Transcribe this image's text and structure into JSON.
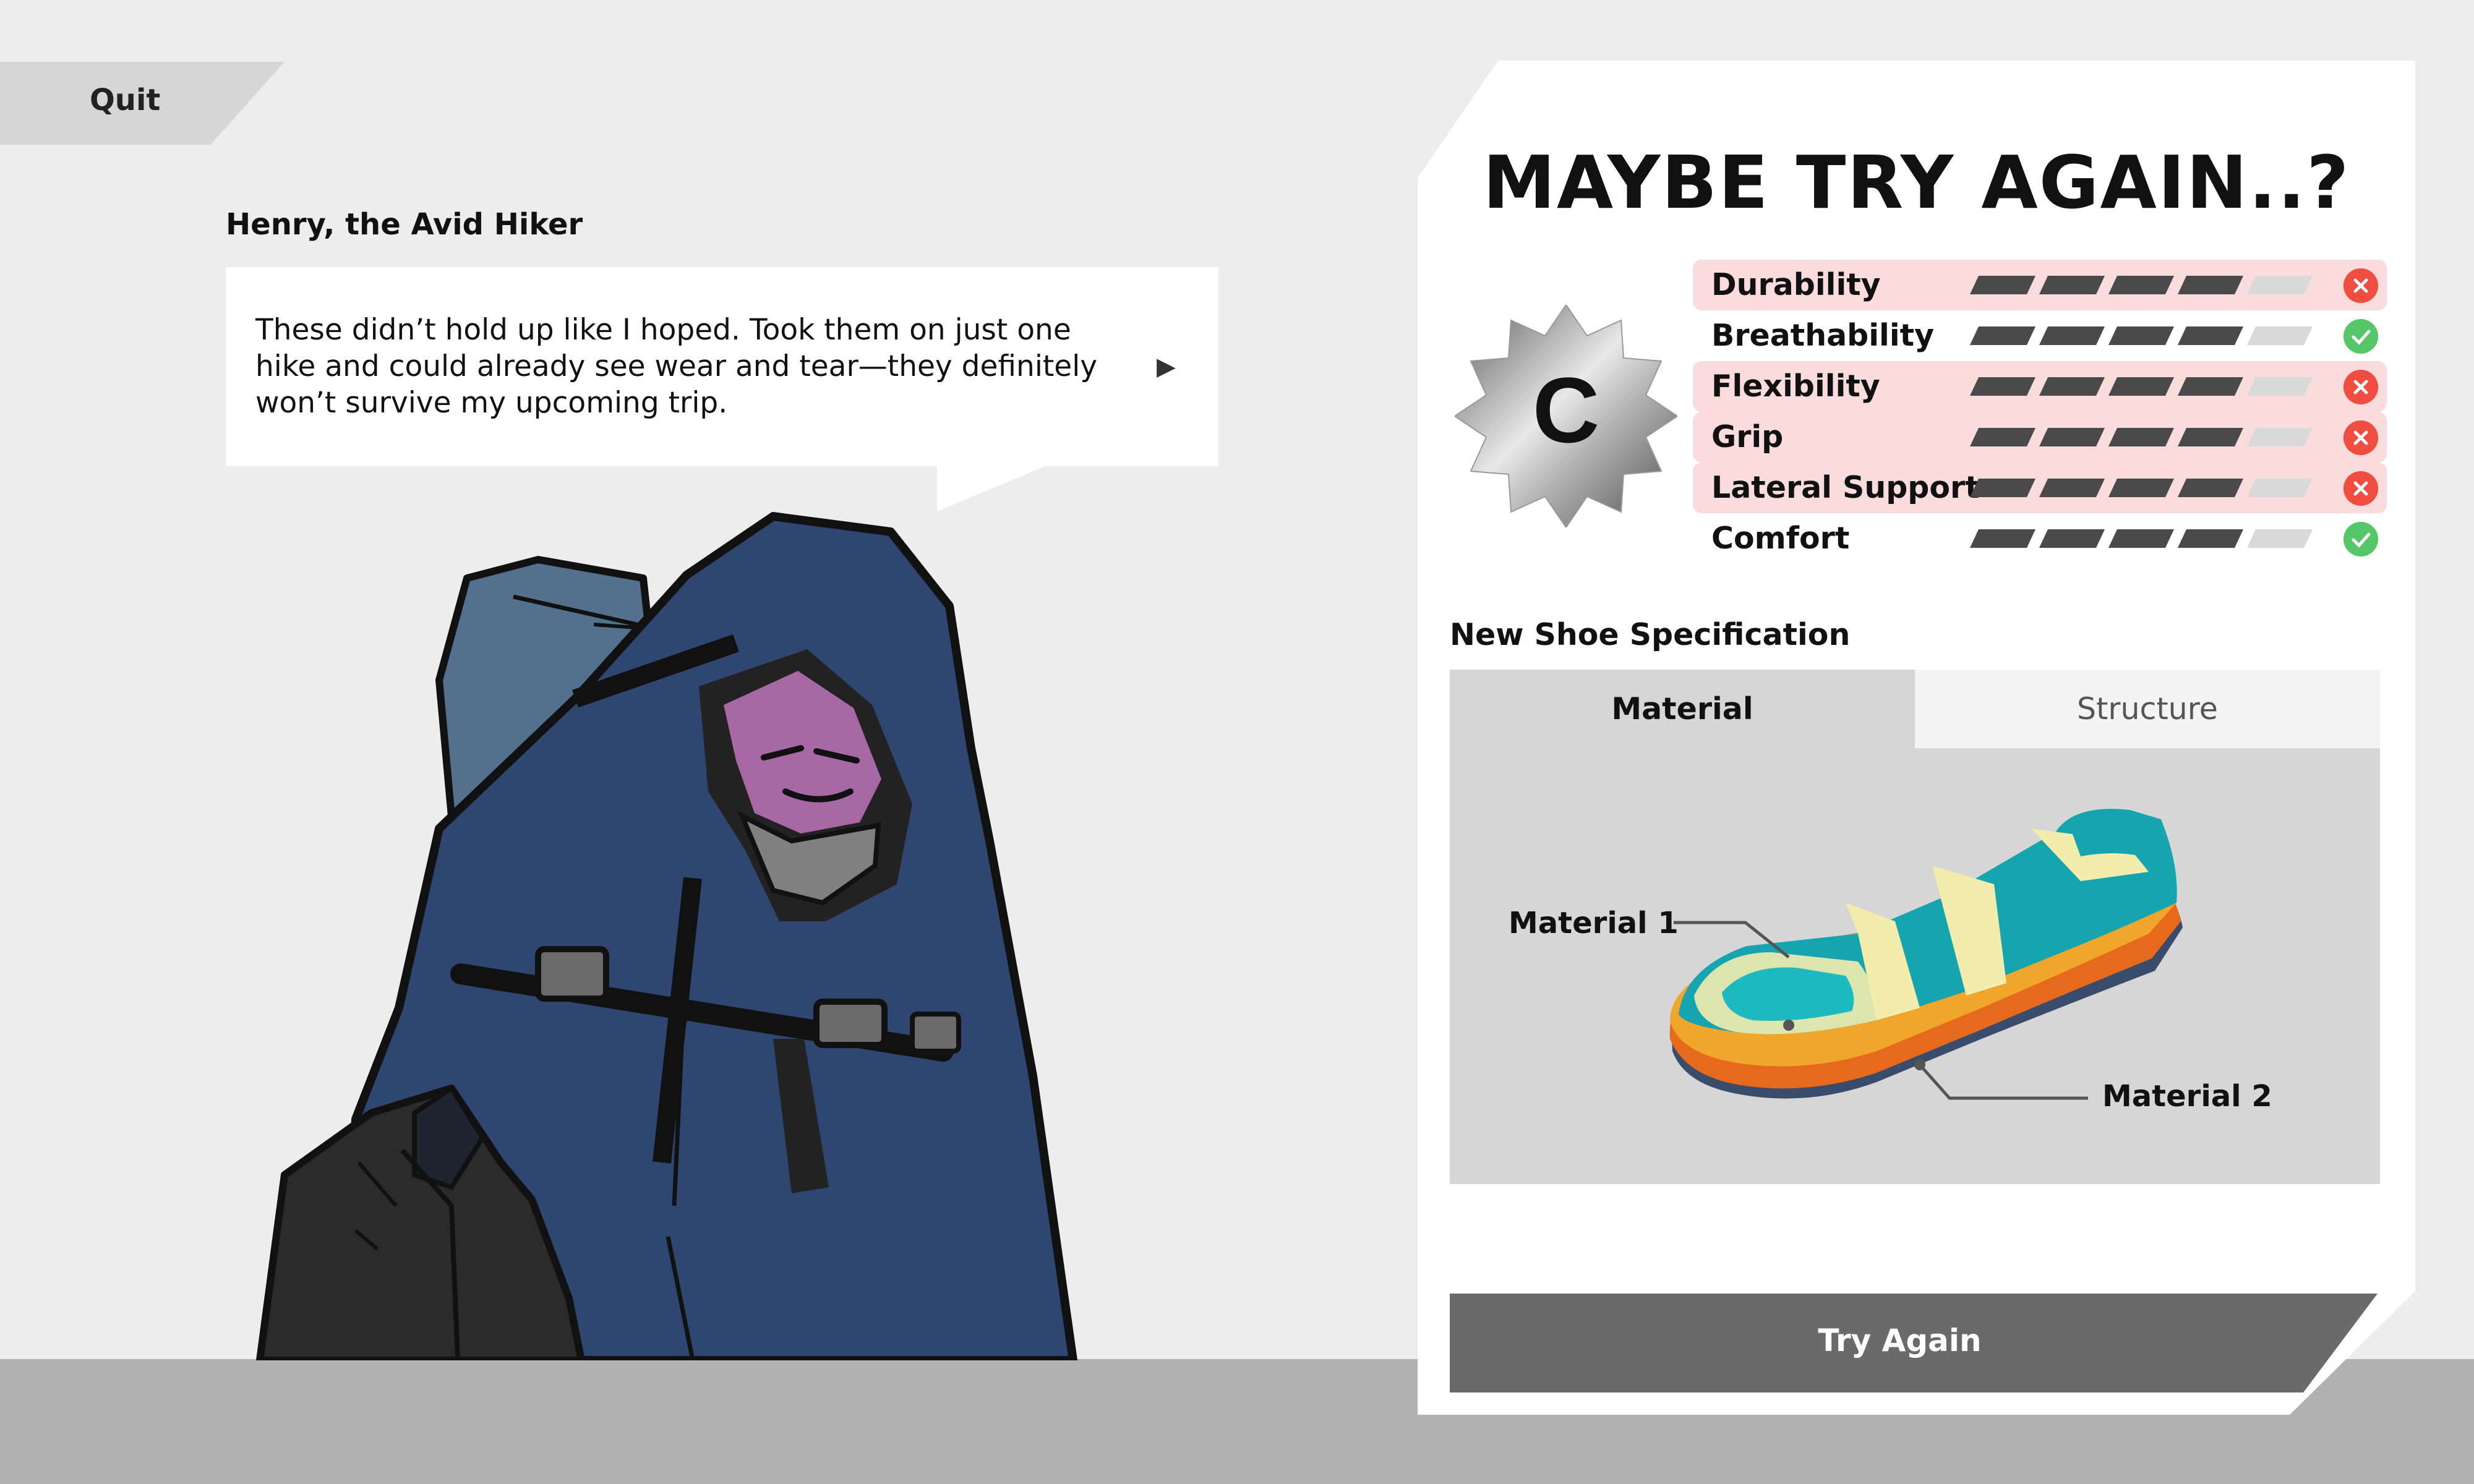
{
  "quit_label": "Quit",
  "dialogue": {
    "speaker": "Henry, the Avid Hiker",
    "text": "These didn’t hold up like I hoped. Took them on just one hike and could already see wear and tear—they definitely won’t survive my upcoming trip."
  },
  "result": {
    "headline": "MAYBE TRY AGAIN..?",
    "grade": "C",
    "stats": [
      {
        "label": "Durability",
        "level": 0.8,
        "status": "fail"
      },
      {
        "label": "Breathability",
        "level": 0.8,
        "status": "pass"
      },
      {
        "label": "Flexibility",
        "level": 0.8,
        "status": "fail"
      },
      {
        "label": "Grip",
        "level": 0.8,
        "status": "fail"
      },
      {
        "label": "Lateral Support",
        "level": 0.8,
        "status": "fail"
      },
      {
        "label": "Comfort",
        "level": 0.8,
        "status": "pass"
      }
    ]
  },
  "spec": {
    "title": "New Shoe Specification",
    "tabs": [
      "Material",
      "Structure"
    ],
    "active_tab": "Material",
    "material_labels": [
      "Material 1",
      "Material 2"
    ]
  },
  "try_again_label": "Try Again",
  "colors": {
    "background": "#ededed",
    "fail_row": "#fbdcdc",
    "fail_icon": "#ef4d40",
    "pass_icon": "#55c768",
    "bar_filled": "#4a4a4a",
    "bar_empty": "#d9d9d9",
    "button": "#6a6a6a"
  }
}
